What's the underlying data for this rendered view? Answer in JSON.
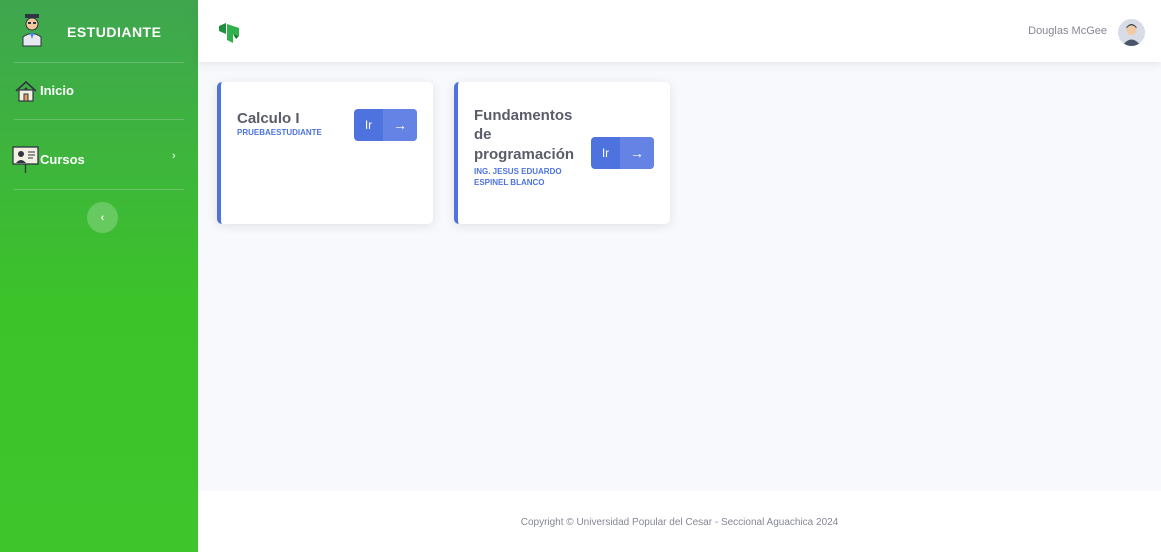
{
  "sidebar": {
    "brand_text": "ESTUDIANTE",
    "items": [
      {
        "label": "Inicio",
        "icon": "house-icon"
      },
      {
        "label": "Cursos",
        "icon": "teacher-board-icon",
        "chevron": "›"
      }
    ],
    "toggle_glyph": "‹"
  },
  "topbar": {
    "logo": "university-logo",
    "user_name": "Douglas McGee",
    "avatar_icon": "user-avatar-icon"
  },
  "courses": [
    {
      "title": "Calculo I",
      "teacher": "PRUEBAESTUDIANTE",
      "button_label": "Ir",
      "arrow": "→"
    },
    {
      "title": "Fundamentos de programación",
      "title_lines": [
        "Fundamentos",
        "de",
        "programación"
      ],
      "teacher_lines": [
        "ING. JESUS EDUARDO",
        "ESPINEL BLANCO"
      ],
      "button_label": "Ir",
      "arrow": "→"
    }
  ],
  "footer": {
    "copyright": "Copyright © Universidad Popular del Cesar - Seccional Aguachica 2024"
  },
  "colors": {
    "sidebar_top": "#3fa64f",
    "sidebar_bottom": "#3ec52c",
    "primary": "#4e73df",
    "background": "#f8f9fc"
  }
}
